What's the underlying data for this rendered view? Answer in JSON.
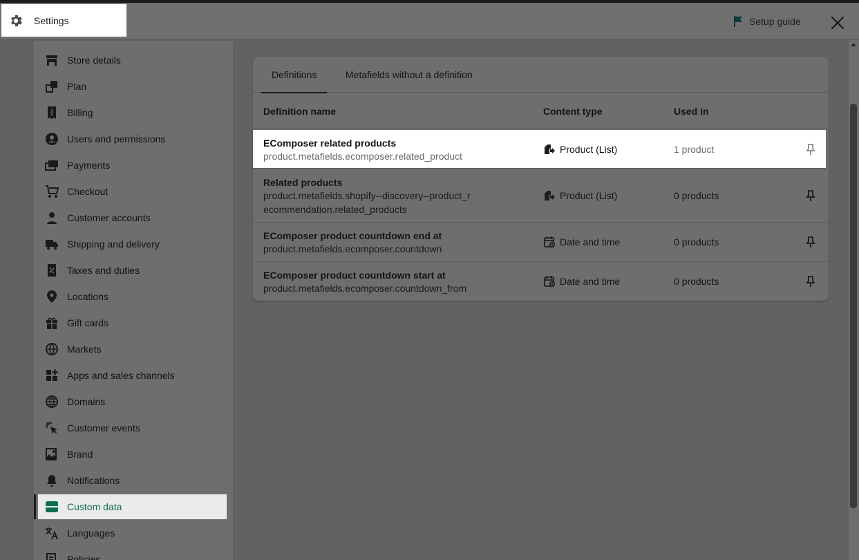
{
  "header": {
    "title": "Settings",
    "setup_guide": "Setup guide"
  },
  "sidebar": {
    "items": [
      {
        "label": "Store details",
        "icon": "store-icon"
      },
      {
        "label": "Plan",
        "icon": "plan-icon"
      },
      {
        "label": "Billing",
        "icon": "billing-icon"
      },
      {
        "label": "Users and permissions",
        "icon": "user-icon"
      },
      {
        "label": "Payments",
        "icon": "payments-icon"
      },
      {
        "label": "Checkout",
        "icon": "cart-icon"
      },
      {
        "label": "Customer accounts",
        "icon": "person-icon"
      },
      {
        "label": "Shipping and delivery",
        "icon": "truck-icon"
      },
      {
        "label": "Taxes and duties",
        "icon": "receipt-icon"
      },
      {
        "label": "Locations",
        "icon": "location-pin-icon"
      },
      {
        "label": "Gift cards",
        "icon": "gift-icon"
      },
      {
        "label": "Markets",
        "icon": "globe-icon"
      },
      {
        "label": "Apps and sales channels",
        "icon": "apps-icon"
      },
      {
        "label": "Domains",
        "icon": "domain-globe-icon"
      },
      {
        "label": "Customer events",
        "icon": "cursor-click-icon"
      },
      {
        "label": "Brand",
        "icon": "brand-image-icon"
      },
      {
        "label": "Notifications",
        "icon": "bell-icon"
      },
      {
        "label": "Custom data",
        "icon": "custom-data-icon",
        "active": true
      },
      {
        "label": "Languages",
        "icon": "translate-icon"
      },
      {
        "label": "Policies",
        "icon": "policies-icon"
      }
    ]
  },
  "main": {
    "tabs": [
      {
        "label": "Definitions",
        "active": true
      },
      {
        "label": "Metafields without a definition",
        "active": false
      }
    ],
    "columns": {
      "name": "Definition name",
      "content_type": "Content type",
      "used_in": "Used in"
    },
    "rows": [
      {
        "name": "EComposer related products",
        "key": "product.metafields.ecomposer.related_product",
        "content_type": "Product (List)",
        "type_icon": "product-list-icon",
        "used_in": "1 product"
      },
      {
        "name": "Related products",
        "key": "product.metafields.shopify--discovery--product_recommendation.related_products",
        "content_type": "Product (List)",
        "type_icon": "product-list-icon",
        "used_in": "0 products"
      },
      {
        "name": "EComposer product countdown end at",
        "key": "product.metafields.ecomposer.countdown",
        "content_type": "Date and time",
        "type_icon": "calendar-clock-icon",
        "used_in": "0 products"
      },
      {
        "name": "EComposer product countdown start at",
        "key": "product.metafields.ecomposer.countdown_from",
        "content_type": "Date and time",
        "type_icon": "calendar-clock-icon",
        "used_in": "0 products"
      }
    ]
  },
  "colors": {
    "overlay": "#626262",
    "accent_active": "#0f6e52",
    "highlight": "#ffffff"
  }
}
